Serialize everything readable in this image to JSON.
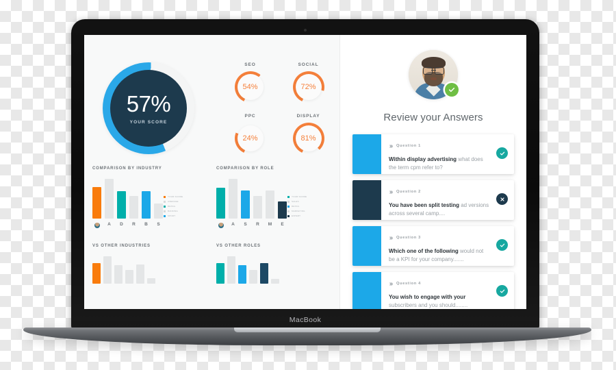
{
  "device": {
    "brand_label": "MacBook",
    "webcam": "webcam-dot"
  },
  "dashboard": {
    "score": {
      "value": "57%",
      "caption": "YOUR SCORE",
      "percent": 57,
      "ring_color": "#2aa8e8",
      "core_color": "#1d3a4d"
    },
    "gauges": [
      {
        "title": "SEO",
        "value": "54%",
        "percent": 54,
        "color": "#f5803b"
      },
      {
        "title": "SOCIAL",
        "value": "72%",
        "percent": 72,
        "color": "#f5803b"
      },
      {
        "title": "PPC",
        "value": "24%",
        "percent": 24,
        "color": "#f5803b"
      },
      {
        "title": "DISPLAY",
        "value": "81%",
        "percent": 81,
        "color": "#f5803b"
      }
    ],
    "charts": [
      {
        "title": "COMPARISON BY INDUSTRY",
        "axis_first_is_avatar": true,
        "categories": [
          "",
          "A",
          "D",
          "R",
          "B",
          "S"
        ],
        "values": [
          46,
          58,
          40,
          33,
          40,
          22
        ],
        "colors": [
          "#f97c0c",
          "#e4e6e7",
          "#00afaa",
          "#e4e6e7",
          "#1ca8e8",
          "#e4e6e7"
        ],
        "legend": [
          {
            "label": "YOUR SCORE",
            "color": "#f97c0c"
          },
          {
            "label": "AVERAGE",
            "color": "#d7d9da"
          },
          {
            "label": "RETAIL",
            "color": "#00afaa"
          },
          {
            "label": "BANKING",
            "color": "#d7d9da"
          },
          {
            "label": "SPORT",
            "color": "#1ca8e8"
          }
        ]
      },
      {
        "title": "COMPARISON BY ROLE",
        "axis_first_is_avatar": true,
        "categories": [
          "",
          "A",
          "S",
          "R",
          "M",
          "E"
        ],
        "values": [
          45,
          58,
          41,
          33,
          41,
          25
        ],
        "colors": [
          "#00afaa",
          "#e4e6e7",
          "#1ca8e8",
          "#e4e6e7",
          "#e4e6e7",
          "#1d3a4d"
        ],
        "legend": [
          {
            "label": "YOUR SCORE",
            "color": "#00afaa"
          },
          {
            "label": "SALES",
            "color": "#d7d9da"
          },
          {
            "label": "RETAIL",
            "color": "#1ca8e8"
          },
          {
            "label": "MARKETING",
            "color": "#d7d9da"
          },
          {
            "label": "EXPERT",
            "color": "#1d3a4d"
          }
        ]
      }
    ],
    "small_charts": [
      {
        "title": "VS OTHER INDUSTRIES",
        "values": [
          30,
          40,
          27,
          20,
          28,
          8
        ],
        "colors": [
          "#f97c0c",
          "#e4e6e7",
          "#e4e6e7",
          "#e4e6e7",
          "#e4e6e7",
          "#e4e6e7"
        ]
      },
      {
        "title": "VS OTHER ROLES",
        "values": [
          30,
          40,
          27,
          20,
          30,
          7
        ],
        "colors": [
          "#00afaa",
          "#e4e6e7",
          "#1ca8e8",
          "#e4e6e7",
          "#1d4965",
          "#e4e6e7"
        ]
      }
    ]
  },
  "review": {
    "avatar_name": "user-avatar",
    "badge_icon": "check-icon",
    "badge_color": "#6fbe44",
    "title": "Review your Answers",
    "questions": [
      {
        "number": "Question 1",
        "bold": "Within display advertising",
        "rest": " what does the term cpm refer to?",
        "thumb_color": "#1ca8e8",
        "status": "correct",
        "status_icon": "check-icon"
      },
      {
        "number": "Question 2",
        "bold": "You have been split testing",
        "rest": " ad versions across several camp....",
        "thumb_color": "#1d3a4d",
        "status": "wrong",
        "status_icon": "close-icon"
      },
      {
        "number": "Question 3",
        "bold": "Which one of the following",
        "rest": " would not be a KPI for your company.......",
        "thumb_color": "#1ca8e8",
        "status": "correct",
        "status_icon": "check-icon"
      },
      {
        "number": "Question 4",
        "bold": "You wish to engage with your",
        "rest": " subscribers and you should........",
        "thumb_color": "#1ca8e8",
        "status": "correct",
        "status_icon": "check-icon"
      }
    ]
  }
}
